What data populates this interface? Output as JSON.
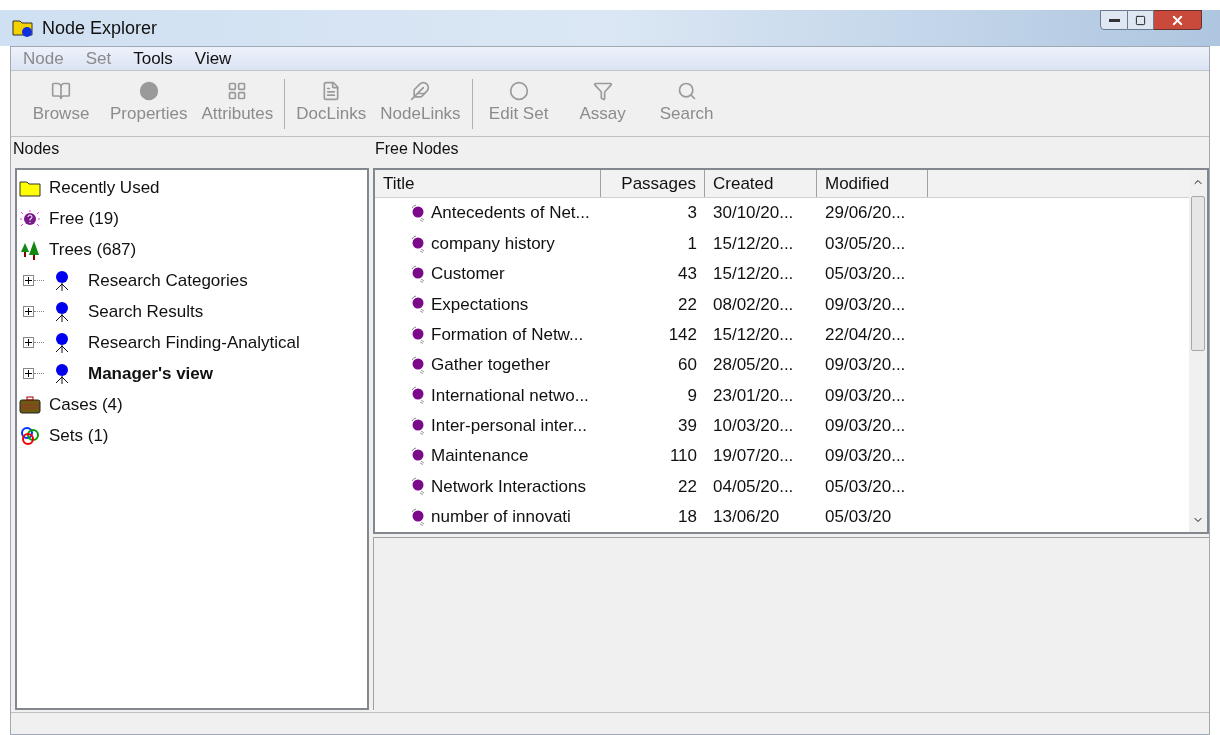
{
  "window": {
    "title": "Node Explorer"
  },
  "menu": [
    {
      "label": "Node",
      "disabled": true
    },
    {
      "label": "Set",
      "disabled": true
    },
    {
      "label": "Tools",
      "disabled": false
    },
    {
      "label": "View",
      "disabled": false
    }
  ],
  "toolbar": [
    {
      "kind": "browse",
      "label": "Browse",
      "disabled": true
    },
    {
      "kind": "properties",
      "label": "Properties",
      "disabled": true
    },
    {
      "kind": "attributes",
      "label": "Attributes",
      "disabled": true,
      "separator_after": true
    },
    {
      "kind": "doclinks",
      "label": "DocLinks",
      "disabled": true
    },
    {
      "kind": "nodelinks",
      "label": "NodeLinks",
      "disabled": true,
      "separator_after": true
    },
    {
      "kind": "editset",
      "label": "Edit Set",
      "disabled": true
    },
    {
      "kind": "assay",
      "label": "Assay",
      "disabled": true
    },
    {
      "kind": "search",
      "label": "Search",
      "disabled": true
    }
  ],
  "nodes_panel": {
    "title": "Nodes",
    "items": [
      {
        "kind": "folder",
        "label": "Recently Used",
        "bold": false
      },
      {
        "kind": "free",
        "label": "Free (19)",
        "bold": false
      },
      {
        "kind": "trees",
        "label": "Trees (687)",
        "bold": false,
        "children": [
          {
            "kind": "tree",
            "label": "Research Categories",
            "bold": false,
            "expanded": false
          },
          {
            "kind": "tree",
            "label": "Search Results",
            "bold": false,
            "expanded": false
          },
          {
            "kind": "tree",
            "label": "Research Finding-Analytical",
            "bold": false,
            "expanded": false
          },
          {
            "kind": "tree",
            "label": "Manager's view",
            "bold": true,
            "expanded": false
          }
        ]
      },
      {
        "kind": "cases",
        "label": "Cases (4)",
        "bold": false
      },
      {
        "kind": "sets",
        "label": "Sets (1)",
        "bold": false
      }
    ]
  },
  "list_panel": {
    "title": "Free Nodes",
    "columns": [
      "Title",
      "Passages",
      "Created",
      "Modified"
    ],
    "rows": [
      [
        "Antecedents of Net...",
        "3",
        "30/10/20...",
        "29/06/20..."
      ],
      [
        "company history",
        "1",
        "15/12/20...",
        "03/05/20..."
      ],
      [
        "Customer",
        "43",
        "15/12/20...",
        "05/03/20..."
      ],
      [
        "Expectations",
        "22",
        "08/02/20...",
        "09/03/20..."
      ],
      [
        "Formation of Netw...",
        "142",
        "15/12/20...",
        "22/04/20..."
      ],
      [
        "Gather together",
        "60",
        "28/05/20...",
        "09/03/20..."
      ],
      [
        "International netwo...",
        "9",
        "23/01/20...",
        "09/03/20..."
      ],
      [
        "Inter-personal inter...",
        "39",
        "10/03/20...",
        "09/03/20..."
      ],
      [
        "Maintenance",
        "110",
        "19/07/20...",
        "09/03/20..."
      ],
      [
        "Network Interactions",
        "22",
        "04/05/20...",
        "05/03/20..."
      ],
      [
        "number of innovati",
        "18",
        "13/06/20",
        "05/03/20"
      ]
    ]
  }
}
